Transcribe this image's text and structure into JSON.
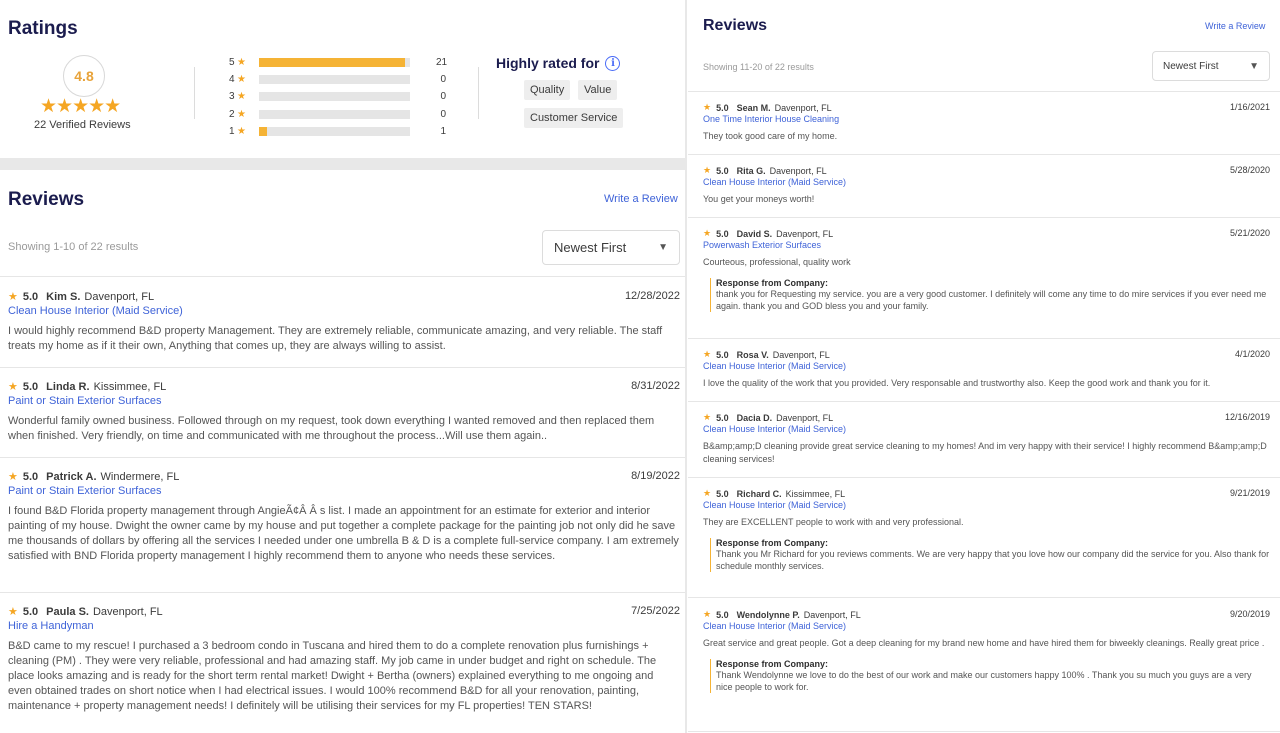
{
  "ratings": {
    "title": "Ratings",
    "average": "4.8",
    "stars": "★★★★★",
    "verified_reviews": "22 Verified Reviews",
    "distribution": [
      {
        "stars": "5",
        "count": "21",
        "fraction": 0.97
      },
      {
        "stars": "4",
        "count": "0",
        "fraction": 0
      },
      {
        "stars": "3",
        "count": "0",
        "fraction": 0
      },
      {
        "stars": "2",
        "count": "0",
        "fraction": 0
      },
      {
        "stars": "1",
        "count": "1",
        "fraction": 0.05
      }
    ],
    "highly_rated_for": "Highly rated for",
    "info_icon": "i",
    "tags": [
      "Quality",
      "Value",
      "Customer Service"
    ]
  },
  "colors": {
    "accent_star": "#f5a623",
    "bar_fill": "#f5b335",
    "link": "#3f63d8",
    "heading": "#1b1c4e"
  },
  "left_reviews": {
    "title": "Reviews",
    "write_review": "Write a Review",
    "showing": "Showing 1-10 of 22 results",
    "sort": "Newest First",
    "items": [
      {
        "score": "5.0",
        "name": "Kim S.",
        "location": "Davenport, FL",
        "date": "12/28/2022",
        "service": "Clean House Interior (Maid Service)",
        "text": "I would highly recommend B&D property Management. They are extremely reliable, communicate amazing, and very reliable. The staff treats my home as if it their own, Anything that comes up, they are always willing to assist."
      },
      {
        "score": "5.0",
        "name": "Linda R.",
        "location": "Kissimmee, FL",
        "date": "8/31/2022",
        "service": "Paint or Stain Exterior Surfaces",
        "text": "Wonderful family owned business. Followed through on my request, took down everything I wanted removed and then replaced them when finished. Very friendly, on time and communicated with me throughout the process...Will use them again.."
      },
      {
        "score": "5.0",
        "name": "Patrick A.",
        "location": "Windermere, FL",
        "date": "8/19/2022",
        "service": "Paint or Stain Exterior Surfaces",
        "text": "I found B&D Florida property management through AngieÃ¢Â Â s list. I made an appointment for an estimate for exterior and interior painting of my house. Dwight the owner came by my house and put together a complete package for the painting job not only did he save me thousands of dollars by offering all the services I needed under one umbrella B & D is a complete full-service company. I am extremely satisfied with BND Florida property management I highly recommend them to anyone who needs these services."
      },
      {
        "score": "5.0",
        "name": "Paula S.",
        "location": "Davenport, FL",
        "date": "7/25/2022",
        "service": "Hire a Handyman",
        "text": "B&D came to my rescue! I purchased a 3 bedroom condo in Tuscana and hired them to do a complete renovation plus furnishings + cleaning (PM) . They were very reliable, professional and had amazing staff. My job came in under budget and right on schedule. The place looks amazing and is ready for the short term rental market! Dwight + Bertha (owners) explained everything to me ongoing and even obtained trades on short notice when I had electrical issues. I would 100% recommend B&D for all your renovation, painting, maintenance + property management needs! I definitely will be utilising their services for my FL properties! TEN STARS!"
      }
    ]
  },
  "right_reviews": {
    "title": "Reviews",
    "write_review": "Write a Review",
    "showing": "Showing 11-20 of 22 results",
    "sort": "Newest First",
    "response_label": "Response from Company:",
    "items": [
      {
        "score": "5.0",
        "name": "Sean M.",
        "location": "Davenport, FL",
        "date": "1/16/2021",
        "service": "One Time Interior House Cleaning",
        "text": "They took good care of my home.",
        "response": ""
      },
      {
        "score": "5.0",
        "name": "Rita G.",
        "location": "Davenport, FL",
        "date": "5/28/2020",
        "service": "Clean House Interior (Maid Service)",
        "text": "You get your moneys worth!",
        "response": ""
      },
      {
        "score": "5.0",
        "name": "David S.",
        "location": "Davenport, FL",
        "date": "5/21/2020",
        "service": "Powerwash Exterior Surfaces",
        "text": "Courteous, professional, quality work",
        "response": "thank you for Requesting my service. you are a very good customer. I definitely will come any time to do mire services if you ever need me again. thank you and GOD bless you and your family."
      },
      {
        "score": "5.0",
        "name": "Rosa V.",
        "location": "Davenport, FL",
        "date": "4/1/2020",
        "service": "Clean House Interior (Maid Service)",
        "text": "I love the quality of the work that you provided. Very responsable and trustworthy also. Keep the good work and thank you for it.",
        "response": ""
      },
      {
        "score": "5.0",
        "name": "Dacia D.",
        "location": "Davenport, FL",
        "date": "12/16/2019",
        "service": "Clean House Interior (Maid Service)",
        "text": "B&amp;amp;D cleaning provide great service cleaning to my homes! And im very happy with their service! I highly recommend B&amp;amp;D cleaning services!",
        "response": ""
      },
      {
        "score": "5.0",
        "name": "Richard C.",
        "location": "Kissimmee, FL",
        "date": "9/21/2019",
        "service": "Clean House Interior (Maid Service)",
        "text": "They are EXCELLENT people to work with and very professional.",
        "response": "Thank you Mr Richard for you reviews comments. We are very happy that you love how our company did the service for you. Also thank for schedule monthly services."
      },
      {
        "score": "5.0",
        "name": "Wendolynne P.",
        "location": "Davenport, FL",
        "date": "9/20/2019",
        "service": "Clean House Interior (Maid Service)",
        "text": "Great service and great people. Got a deep cleaning for my brand new home and have hired them for biweekly cleanings. Really great price .",
        "response": "Thank Wendolynne we love to do the best of our work and make our customers happy 100% . Thank you su much you guys are a very nice people to work for."
      }
    ]
  }
}
